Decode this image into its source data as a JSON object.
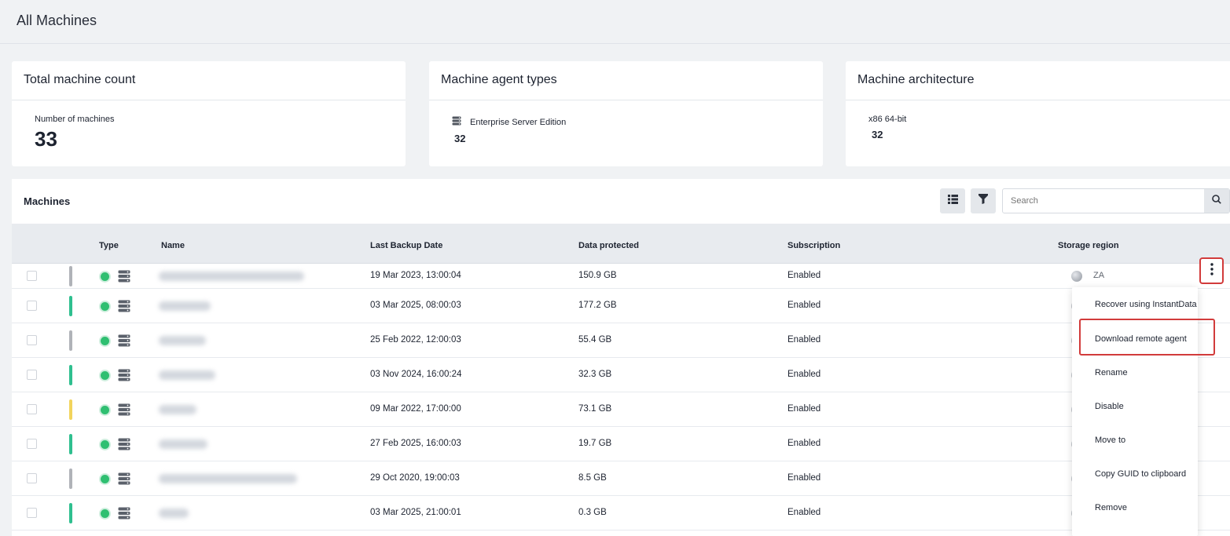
{
  "page": {
    "title": "All Machines"
  },
  "cards": {
    "total": {
      "title": "Total machine count",
      "label": "Number of machines",
      "value": "33"
    },
    "agents": {
      "title": "Machine agent types",
      "type_label": "Enterprise Server Edition",
      "type_icon": "server-icon",
      "value": "32"
    },
    "arch": {
      "title": "Machine architecture",
      "label": "x86 64-bit",
      "value": "32"
    }
  },
  "machines": {
    "title": "Machines",
    "search_placeholder": "Search",
    "columns": {
      "type": "Type",
      "name": "Name",
      "last_backup": "Last Backup Date",
      "data_protected": "Data protected",
      "subscription": "Subscription",
      "storage_region": "Storage region"
    },
    "rows": [
      {
        "status_color": "#b0b3b8",
        "last_backup": "19 Mar 2023, 13:00:04",
        "data_protected": "150.9 GB",
        "subscription": "Enabled",
        "region": "ZA"
      },
      {
        "status_color": "#2fbf8f",
        "last_backup": "03 Mar 2025, 08:00:03",
        "data_protected": "177.2 GB",
        "subscription": "Enabled"
      },
      {
        "status_color": "#b0b3b8",
        "last_backup": "25 Feb 2022, 12:00:03",
        "data_protected": "55.4 GB",
        "subscription": "Enabled"
      },
      {
        "status_color": "#2fbf8f",
        "last_backup": "03 Nov 2024, 16:00:24",
        "data_protected": "32.3 GB",
        "subscription": "Enabled"
      },
      {
        "status_color": "#f2d45c",
        "last_backup": "09 Mar 2022, 17:00:00",
        "data_protected": "73.1 GB",
        "subscription": "Enabled"
      },
      {
        "status_color": "#2fbf8f",
        "last_backup": "27 Feb 2025, 16:00:03",
        "data_protected": "19.7 GB",
        "subscription": "Enabled"
      },
      {
        "status_color": "#b0b3b8",
        "last_backup": "29 Oct 2020, 19:00:03",
        "data_protected": "8.5 GB",
        "subscription": "Enabled"
      },
      {
        "status_color": "#2fbf8f",
        "last_backup": "03 Mar 2025, 21:00:01",
        "data_protected": "0.3 GB",
        "subscription": "Enabled"
      }
    ]
  },
  "context_menu": {
    "items": [
      "Recover using InstantData",
      "Download remote agent",
      "Rename",
      "Disable",
      "Move to",
      "Copy GUID to clipboard",
      "Remove"
    ]
  },
  "colors": {
    "highlight": "#d23b3b",
    "online": "#2fbf71"
  }
}
